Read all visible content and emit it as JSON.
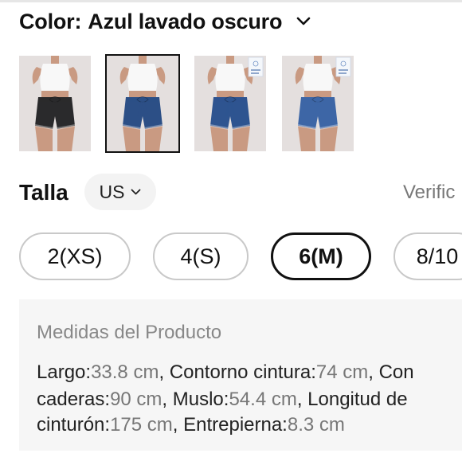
{
  "color": {
    "label": "Color:",
    "value": "Azul lavado oscuro",
    "chevron_icon": "chevron-down-icon"
  },
  "thumbnails": [
    {
      "variant": "black denim",
      "shorts_color": "#2a2a2c",
      "selected": false
    },
    {
      "variant": "dark blue wash",
      "shorts_color": "#2c4f86",
      "selected": true
    },
    {
      "variant": "dark blue",
      "shorts_color": "#2e5490",
      "selected": false
    },
    {
      "variant": "medium blue wash",
      "shorts_color": "#3d66a6",
      "selected": false
    }
  ],
  "size": {
    "label": "Talla",
    "unit": "US",
    "verify_link": "Verific",
    "options": [
      {
        "label": "2(XS)",
        "selected": false
      },
      {
        "label": "4(S)",
        "selected": false
      },
      {
        "label": "6(M)",
        "selected": true
      },
      {
        "label": "8/10",
        "selected": false
      }
    ]
  },
  "measurements": {
    "title": "Medidas del Producto",
    "line1": [
      {
        "k": "Largo:",
        "v": "33.8 cm"
      },
      {
        "k": ", Contorno cintura:",
        "v": "74 cm"
      },
      {
        "k": ", Con",
        "v": ""
      }
    ],
    "line2": [
      {
        "k": "caderas:",
        "v": "90 cm"
      },
      {
        "k": ", Muslo:",
        "v": "54.4 cm"
      },
      {
        "k": ", Longitud de",
        "v": ""
      }
    ],
    "line3": [
      {
        "k": "cinturón:",
        "v": "175 cm"
      },
      {
        "k": ", Entrepierna:",
        "v": "8.3 cm"
      }
    ]
  },
  "colors": {
    "text": "#111111",
    "muted": "#777777",
    "pill_border": "#c9c9c9",
    "panel_bg": "#f6f6f6"
  }
}
